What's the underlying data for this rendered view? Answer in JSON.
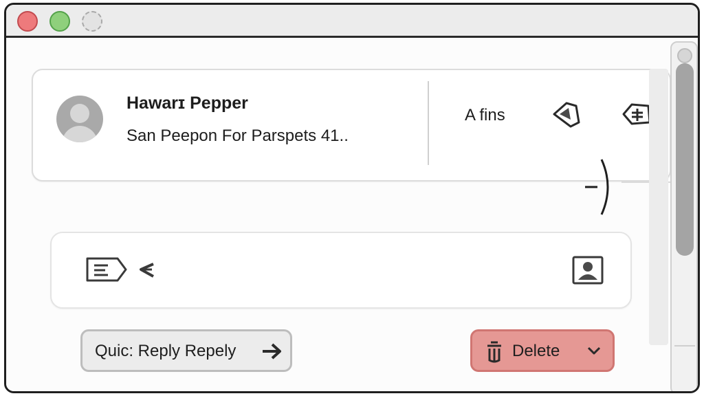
{
  "window": {
    "controls": [
      "close-button",
      "zoom-button",
      "minimize-button"
    ]
  },
  "email": {
    "sender_name": "Hawarɪ Pepper",
    "subject": "San Peepon For Parspets 41..",
    "meta_label": "A fins",
    "header_icons": [
      "tag-icon",
      "tag-plus-icon"
    ]
  },
  "actions": {
    "reply_icon": "reply-icon",
    "contact_icon": "contact-card-icon",
    "quick_reply_label": "Quic: Reply Repely",
    "delete_label": "Delete"
  },
  "colors": {
    "close": "#ee7a7c",
    "zoom": "#8fd07c",
    "delete_bg": "#e59894",
    "quick_reply_bg": "#ececec"
  }
}
